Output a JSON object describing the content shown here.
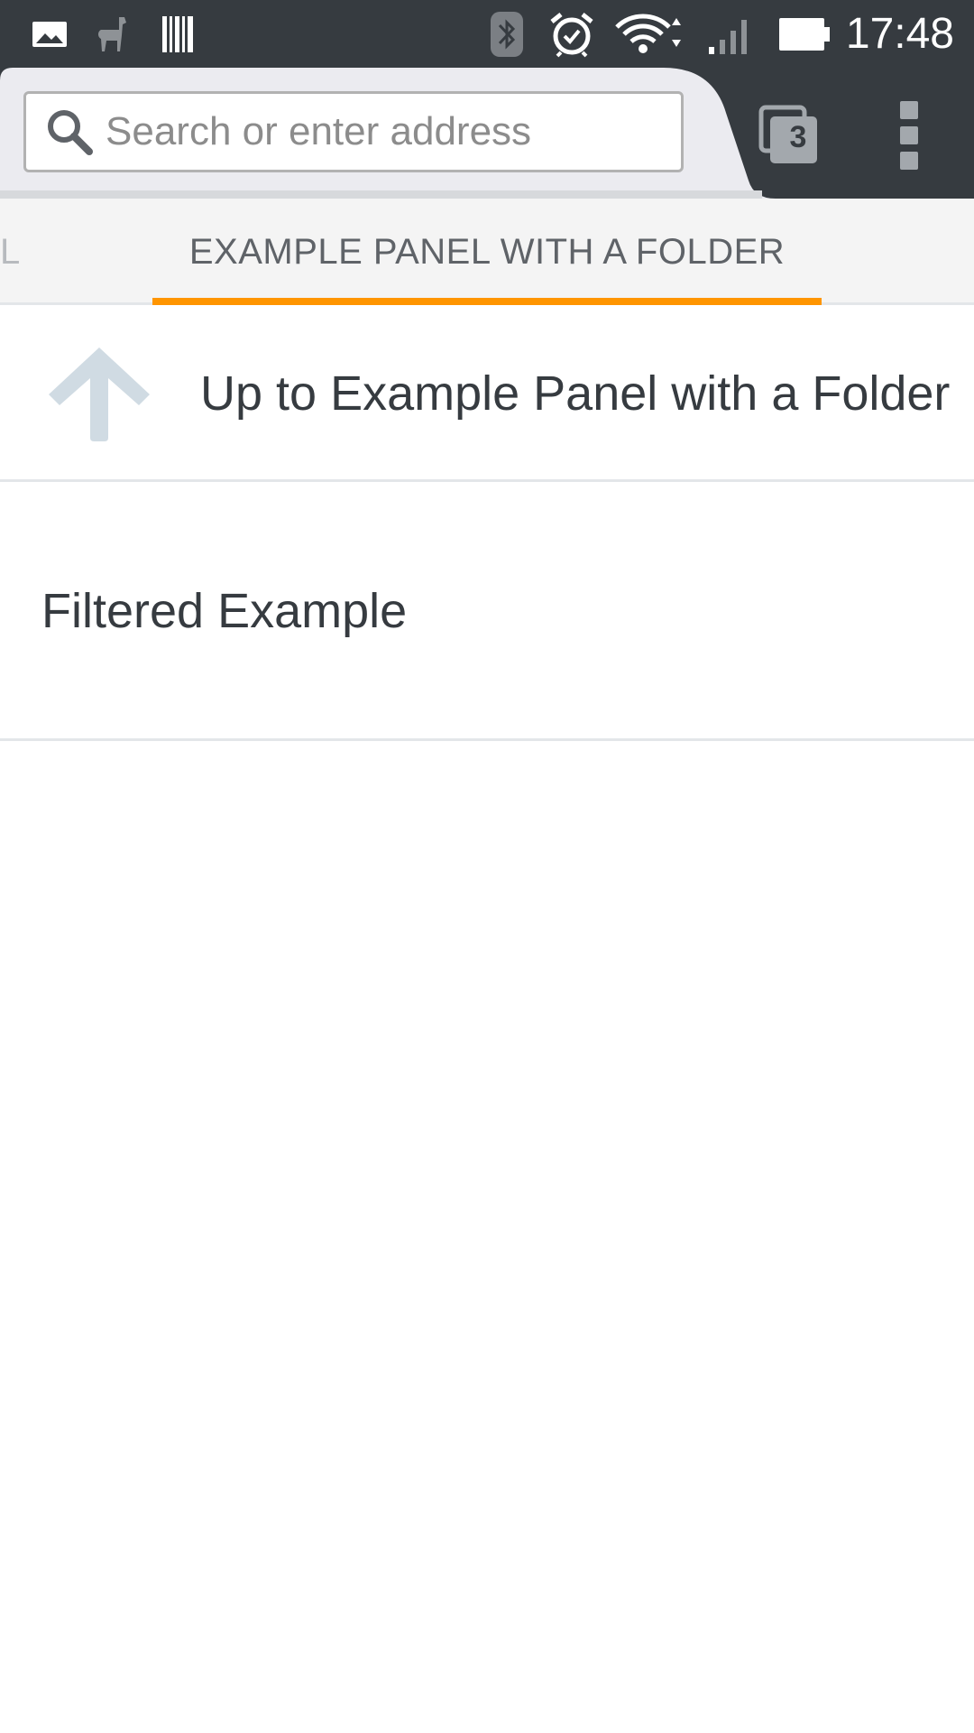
{
  "status_bar": {
    "time": "17:48",
    "icons": [
      "image-notification-icon",
      "llama-icon",
      "barcode-icon",
      "bluetooth-icon",
      "alarm-icon",
      "wifi-icon",
      "signal-icon",
      "battery-icon"
    ]
  },
  "toolbar": {
    "url_placeholder": "Search or enter address",
    "tabs_count": "3",
    "menu_icon": "overflow-menu-icon"
  },
  "panel_tabs": {
    "prev_partial": "L",
    "current": "EXAMPLE PANEL WITH A FOLDER"
  },
  "list": {
    "up_item": "Up to Example Panel with a Folder",
    "items": [
      {
        "label": "Filtered Example"
      }
    ]
  },
  "colors": {
    "toolbar_dark": "#363b40",
    "accent_orange": "#ff9500",
    "tab_strip": "#f4f4f4",
    "divider": "#e3e6e9"
  }
}
